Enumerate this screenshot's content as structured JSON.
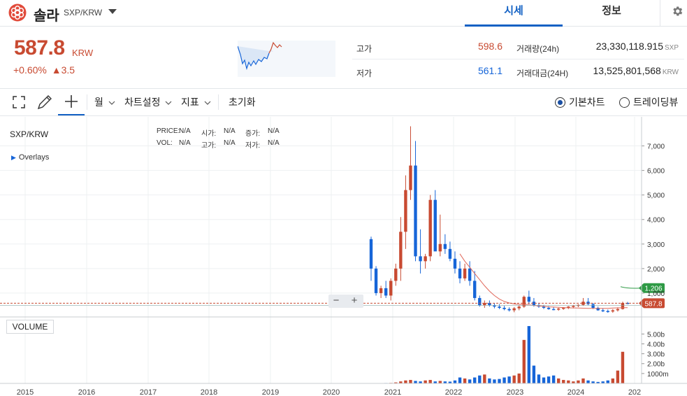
{
  "header": {
    "coin_name": "솔라",
    "pair": "SXP/KRW",
    "tabs": [
      "시세",
      "정보"
    ]
  },
  "price": {
    "value": "587.8",
    "unit": "KRW",
    "change_pct": "+0.60%",
    "change_arrow": "▲",
    "change_abs": "3.5",
    "color": "#c84a31"
  },
  "stats": {
    "high_label": "고가",
    "high_value": "598.6",
    "low_label": "저가",
    "low_value": "561.1",
    "vol_label": "거래량(24h)",
    "vol_value": "23,330,118.915",
    "vol_unit": "SXP",
    "amt_label": "거래대금(24H)",
    "amt_value": "13,525,801,568",
    "amt_unit": "KRW"
  },
  "toolbar": {
    "period": "월",
    "chart_settings": "차트설정",
    "indicators": "지표",
    "reset": "초기화",
    "basic_chart": "기본차트",
    "tradingview": "트레이딩뷰",
    "selected": "basic_chart"
  },
  "chart": {
    "pair_label": "SXP/KRW",
    "overlays": "Overlays",
    "ohlc": {
      "price_label": "PRICE:",
      "price_val": "N/A",
      "open_label": "시가:",
      "open_val": "N/A",
      "rise_label": "증가:",
      "rise_val": "N/A",
      "vol_label": "VOL:",
      "vol_val": "N/A",
      "high_label": "고가:",
      "high_val": "N/A",
      "low_label": "저가:",
      "low_val": "N/A"
    },
    "volume_button": "VOLUME",
    "zoom_minus": "−",
    "zoom_plus": "+",
    "last_price_tag": "587.8",
    "ma_tag": "1,206",
    "colors": {
      "up": "#c84a31",
      "down": "#1665d8",
      "ma": "#e0685a",
      "ma_tag": "#2e9a45"
    }
  },
  "chart_data": {
    "type": "candlestick",
    "x_ticks": [
      "2015",
      "2016",
      "2017",
      "2018",
      "2019",
      "2020",
      "2021",
      "2022",
      "2023",
      "2024",
      "202"
    ],
    "y_ticks": [
      "7,000",
      "6,000",
      "5,000",
      "4,000",
      "3,000",
      "2,000",
      "1,000"
    ],
    "volume_ticks": [
      "5.00b",
      "4.00b",
      "3.00b",
      "2.00b",
      "1000m"
    ],
    "ylim": [
      0,
      7900
    ],
    "candles": [
      {
        "o": 3200,
        "h": 3300,
        "l": 1500,
        "c": 2000
      },
      {
        "o": 2000,
        "h": 2100,
        "l": 900,
        "c": 1000
      },
      {
        "o": 1000,
        "h": 1300,
        "l": 800,
        "c": 1200
      },
      {
        "o": 1200,
        "h": 1500,
        "l": 800,
        "c": 900
      },
      {
        "o": 900,
        "h": 1600,
        "l": 700,
        "c": 1500
      },
      {
        "o": 1500,
        "h": 2200,
        "l": 1300,
        "c": 2000
      },
      {
        "o": 2000,
        "h": 4100,
        "l": 1500,
        "c": 3500
      },
      {
        "o": 3500,
        "h": 5800,
        "l": 2800,
        "c": 5200
      },
      {
        "o": 5200,
        "h": 7800,
        "l": 4800,
        "c": 6200
      },
      {
        "o": 6200,
        "h": 7200,
        "l": 2300,
        "c": 2500
      },
      {
        "o": 2500,
        "h": 3600,
        "l": 1800,
        "c": 2300
      },
      {
        "o": 2300,
        "h": 2600,
        "l": 2000,
        "c": 2500
      },
      {
        "o": 2500,
        "h": 5000,
        "l": 2300,
        "c": 4800
      },
      {
        "o": 4800,
        "h": 5200,
        "l": 2800,
        "c": 2700
      },
      {
        "o": 2700,
        "h": 4200,
        "l": 2500,
        "c": 3000
      },
      {
        "o": 3000,
        "h": 3400,
        "l": 2600,
        "c": 2800
      },
      {
        "o": 2800,
        "h": 3100,
        "l": 2300,
        "c": 2400
      },
      {
        "o": 2400,
        "h": 2700,
        "l": 1800,
        "c": 2000
      },
      {
        "o": 2000,
        "h": 2300,
        "l": 1400,
        "c": 1600
      },
      {
        "o": 1600,
        "h": 2200,
        "l": 1500,
        "c": 2000
      },
      {
        "o": 2000,
        "h": 2300,
        "l": 1300,
        "c": 1500
      },
      {
        "o": 1500,
        "h": 1900,
        "l": 700,
        "c": 800
      },
      {
        "o": 800,
        "h": 900,
        "l": 450,
        "c": 500
      },
      {
        "o": 500,
        "h": 700,
        "l": 400,
        "c": 600
      },
      {
        "o": 600,
        "h": 700,
        "l": 450,
        "c": 500
      },
      {
        "o": 500,
        "h": 600,
        "l": 380,
        "c": 450
      },
      {
        "o": 450,
        "h": 550,
        "l": 350,
        "c": 400
      },
      {
        "o": 400,
        "h": 480,
        "l": 300,
        "c": 350
      },
      {
        "o": 350,
        "h": 420,
        "l": 250,
        "c": 300
      },
      {
        "o": 300,
        "h": 430,
        "l": 220,
        "c": 380
      },
      {
        "o": 380,
        "h": 500,
        "l": 300,
        "c": 450
      },
      {
        "o": 450,
        "h": 900,
        "l": 400,
        "c": 850
      },
      {
        "o": 850,
        "h": 1100,
        "l": 550,
        "c": 650
      },
      {
        "o": 650,
        "h": 800,
        "l": 450,
        "c": 500
      },
      {
        "o": 500,
        "h": 600,
        "l": 400,
        "c": 450
      },
      {
        "o": 450,
        "h": 520,
        "l": 350,
        "c": 400
      },
      {
        "o": 400,
        "h": 470,
        "l": 320,
        "c": 350
      },
      {
        "o": 350,
        "h": 430,
        "l": 300,
        "c": 330
      },
      {
        "o": 330,
        "h": 400,
        "l": 280,
        "c": 370
      },
      {
        "o": 370,
        "h": 430,
        "l": 320,
        "c": 400
      },
      {
        "o": 400,
        "h": 470,
        "l": 350,
        "c": 450
      },
      {
        "o": 450,
        "h": 520,
        "l": 380,
        "c": 480
      },
      {
        "o": 480,
        "h": 550,
        "l": 430,
        "c": 520
      },
      {
        "o": 520,
        "h": 800,
        "l": 480,
        "c": 650
      },
      {
        "o": 650,
        "h": 800,
        "l": 500,
        "c": 550
      },
      {
        "o": 550,
        "h": 600,
        "l": 350,
        "c": 400
      },
      {
        "o": 400,
        "h": 450,
        "l": 280,
        "c": 300
      },
      {
        "o": 300,
        "h": 380,
        "l": 230,
        "c": 270
      },
      {
        "o": 270,
        "h": 330,
        "l": 200,
        "c": 250
      },
      {
        "o": 250,
        "h": 350,
        "l": 200,
        "c": 300
      },
      {
        "o": 300,
        "h": 420,
        "l": 250,
        "c": 350
      },
      {
        "o": 350,
        "h": 650,
        "l": 330,
        "c": 600
      },
      {
        "o": 600,
        "h": 640,
        "l": 550,
        "c": 588
      }
    ],
    "ma": [
      2600,
      2300,
      2050,
      1800,
      1550,
      1300,
      1080,
      900,
      760,
      660,
      600,
      560,
      540,
      530,
      520,
      500,
      480,
      460,
      440,
      430,
      420,
      410,
      400,
      395,
      390,
      385,
      380,
      378,
      376,
      376,
      380,
      390,
      400,
      405,
      408
    ],
    "ma_start_index": 18,
    "volumes": [
      0.02,
      0.02,
      0.03,
      0.04,
      0.05,
      0.1,
      0.2,
      0.3,
      0.35,
      0.25,
      0.2,
      0.3,
      0.35,
      0.2,
      0.25,
      0.2,
      0.18,
      0.3,
      0.6,
      0.5,
      0.4,
      0.6,
      0.8,
      0.9,
      0.5,
      0.4,
      0.45,
      0.6,
      0.7,
      0.8,
      1.0,
      4.4,
      5.8,
      1.8,
      0.9,
      0.6,
      0.7,
      0.8,
      0.5,
      0.35,
      0.3,
      0.2,
      0.3,
      0.5,
      0.3,
      0.2,
      0.15,
      0.2,
      0.3,
      0.5,
      1.3,
      3.2,
      0.0
    ]
  }
}
